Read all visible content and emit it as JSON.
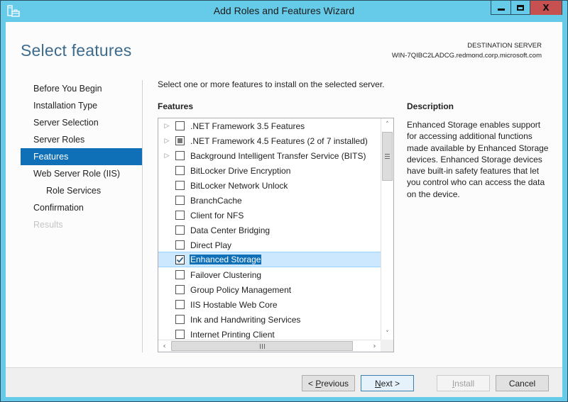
{
  "window": {
    "title": "Add Roles and Features Wizard",
    "icon": "server-manager-icon",
    "controls": {
      "minimize": "minimize",
      "maximize": "maximize",
      "close": "X"
    }
  },
  "header": {
    "page_title": "Select features",
    "destination_label": "DESTINATION SERVER",
    "destination_server": "WIN-7QIBC2LADCG.redmond.corp.microsoft.com"
  },
  "nav": {
    "items": [
      {
        "label": "Before You Begin",
        "state": "normal"
      },
      {
        "label": "Installation Type",
        "state": "normal"
      },
      {
        "label": "Server Selection",
        "state": "normal"
      },
      {
        "label": "Server Roles",
        "state": "normal"
      },
      {
        "label": "Features",
        "state": "active"
      },
      {
        "label": "Web Server Role (IIS)",
        "state": "normal"
      },
      {
        "label": "Role Services",
        "state": "sub"
      },
      {
        "label": "Confirmation",
        "state": "normal"
      },
      {
        "label": "Results",
        "state": "disabled"
      }
    ]
  },
  "main": {
    "instruction": "Select one or more features to install on the selected server.",
    "features_heading": "Features",
    "features": [
      {
        "label": ".NET Framework 3.5 Features",
        "expandable": true,
        "check": "unchecked"
      },
      {
        "label": ".NET Framework 4.5 Features (2 of 7 installed)",
        "expandable": true,
        "check": "partial"
      },
      {
        "label": "Background Intelligent Transfer Service (BITS)",
        "expandable": true,
        "check": "unchecked"
      },
      {
        "label": "BitLocker Drive Encryption",
        "expandable": false,
        "check": "unchecked"
      },
      {
        "label": "BitLocker Network Unlock",
        "expandable": false,
        "check": "unchecked"
      },
      {
        "label": "BranchCache",
        "expandable": false,
        "check": "unchecked"
      },
      {
        "label": "Client for NFS",
        "expandable": false,
        "check": "unchecked"
      },
      {
        "label": "Data Center Bridging",
        "expandable": false,
        "check": "unchecked"
      },
      {
        "label": "Direct Play",
        "expandable": false,
        "check": "unchecked"
      },
      {
        "label": "Enhanced Storage",
        "expandable": false,
        "check": "checked",
        "selected": true
      },
      {
        "label": "Failover Clustering",
        "expandable": false,
        "check": "unchecked"
      },
      {
        "label": "Group Policy Management",
        "expandable": false,
        "check": "unchecked"
      },
      {
        "label": "IIS Hostable Web Core",
        "expandable": false,
        "check": "unchecked"
      },
      {
        "label": "Ink and Handwriting Services",
        "expandable": false,
        "check": "unchecked"
      },
      {
        "label": "Internet Printing Client",
        "expandable": false,
        "check": "unchecked"
      }
    ],
    "description_heading": "Description",
    "description_text": "Enhanced Storage enables support for accessing additional functions made available by Enhanced Storage devices. Enhanced Storage devices have built-in safety features that let you control who can access the data on the device."
  },
  "footer": {
    "previous": {
      "prefix": "< ",
      "accel": "P",
      "rest": "revious"
    },
    "next": {
      "prefix": "",
      "accel": "N",
      "rest": "ext >"
    },
    "install": {
      "prefix": "",
      "accel": "I",
      "rest": "nstall"
    },
    "cancel": "Cancel"
  },
  "colors": {
    "frame": "#66cbe9",
    "accent": "#0f6fb7",
    "title_text": "#3d6b8e",
    "close_button": "#c75050"
  }
}
